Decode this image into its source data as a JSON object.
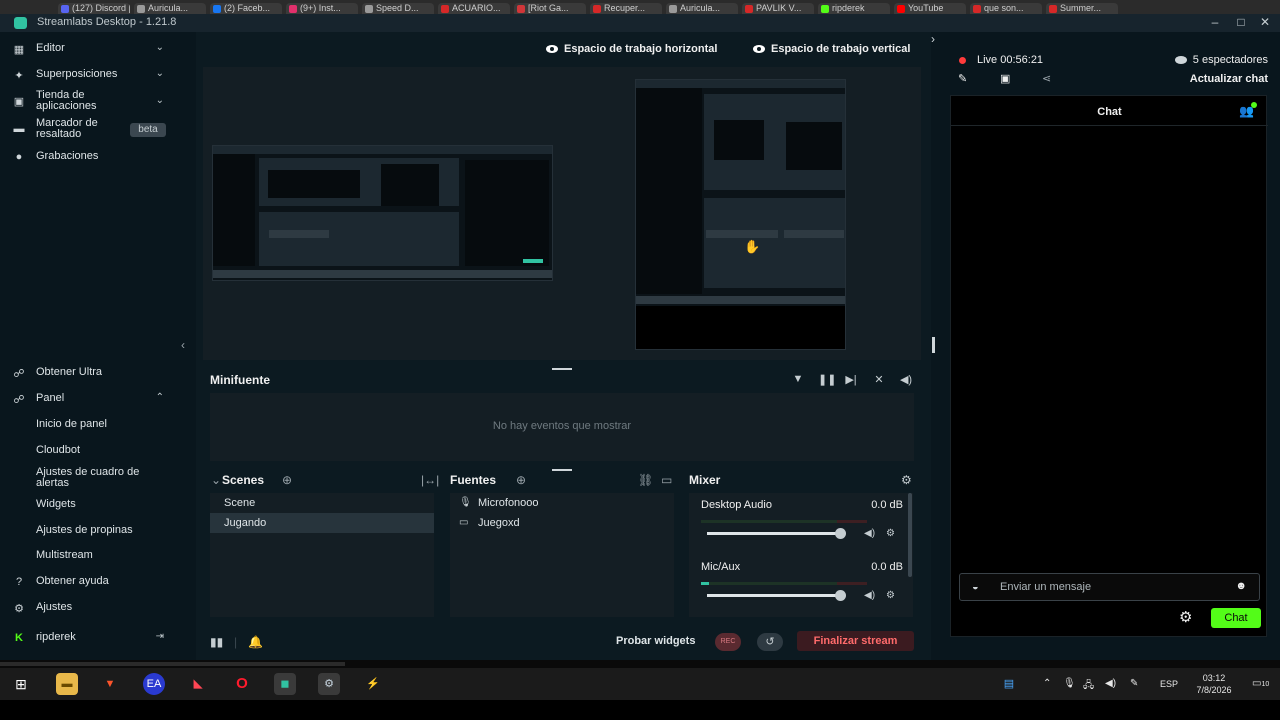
{
  "browser_tabs": [
    {
      "label": "(127) Discord | ...",
      "color": "#5865f2"
    },
    {
      "label": "Auricula...",
      "color": "#9a9a9a"
    },
    {
      "label": "(2) Faceb...",
      "color": "#1877f2"
    },
    {
      "label": "(9+) Inst...",
      "color": "#e1306c"
    },
    {
      "label": "Speed D...",
      "color": "#9a9a9a"
    },
    {
      "label": "ACUARIO...",
      "color": "#d62828"
    },
    {
      "label": "[Riot Ga...",
      "color": "#d13639"
    },
    {
      "label": "Recuper...",
      "color": "#d62828"
    },
    {
      "label": "Auricula...",
      "color": "#9a9a9a"
    },
    {
      "label": "PAVLIK V...",
      "color": "#d62828"
    },
    {
      "label": "ripderek",
      "color": "#53fc18"
    },
    {
      "label": "YouTube",
      "color": "#ff0000"
    },
    {
      "label": "que son...",
      "color": "#d62828"
    },
    {
      "label": "Summer...",
      "color": "#d62828"
    }
  ],
  "window": {
    "title": "Streamlabs Desktop - 1.21.8",
    "minimize": "–",
    "maximize": "□",
    "close": "✕"
  },
  "sidebar": {
    "top_items": [
      {
        "label": "Editor",
        "icon": "grid-icon",
        "chevron": "⌄"
      },
      {
        "label": "Superposiciones",
        "icon": "overlays-icon",
        "chevron": "⌄"
      },
      {
        "label": "Tienda de aplicaciones",
        "icon": "store-icon",
        "chevron": "⌄"
      },
      {
        "label": "Marcador de resaltado",
        "icon": "highlighter-icon",
        "badge": "beta"
      },
      {
        "label": "Grabaciones",
        "icon": "recordings-icon"
      }
    ],
    "bottom_items": {
      "ultra": "Obtener Ultra",
      "panel": "Panel",
      "panel_children": [
        "Inicio de panel",
        "Cloudbot",
        "Ajustes de cuadro de alertas",
        "Widgets",
        "Ajustes de propinas",
        "Multistream"
      ],
      "help": "Obtener ayuda",
      "settings": "Ajustes",
      "user": "ripderek",
      "logout_icon": "⇥"
    }
  },
  "editor": {
    "workspace_horizontal": "Espacio de trabajo horizontal",
    "workspace_vertical": "Espacio de trabajo vertical"
  },
  "minifeed": {
    "title": "Minifuente",
    "empty": "No hay eventos que mostrar"
  },
  "scenes": {
    "title": "Scenes",
    "items": [
      "Scene",
      "Jugando"
    ],
    "selected": "Jugando"
  },
  "sources": {
    "title": "Fuentes",
    "items": [
      {
        "label": "Microfonooo",
        "icon": "microphone-icon"
      },
      {
        "label": "Juegoxd",
        "icon": "monitor-icon"
      }
    ]
  },
  "mixer": {
    "title": "Mixer",
    "channels": [
      {
        "name": "Desktop Audio",
        "db": "0.0 dB",
        "level": 0.0
      },
      {
        "name": "Mic/Aux",
        "db": "0.0 dB",
        "level": 0.05
      }
    ]
  },
  "footer": {
    "test_widgets": "Probar widgets",
    "rec": "REC",
    "end_stream": "Finalizar stream"
  },
  "live": {
    "status": "Live 00:56:21",
    "viewers": "5 espectadores",
    "refresh_chat": "Actualizar chat",
    "chat_title": "Chat",
    "chat_placeholder": "Enviar un mensaje",
    "chat_button": "Chat"
  },
  "taskbar": {
    "language": "ESP",
    "time": "03:12",
    "date": "7/8/2026",
    "notif_count": "10"
  },
  "colors": {
    "accent": "#31c3a2",
    "kick_green": "#53fc18",
    "danger": "#ff6b6b"
  }
}
